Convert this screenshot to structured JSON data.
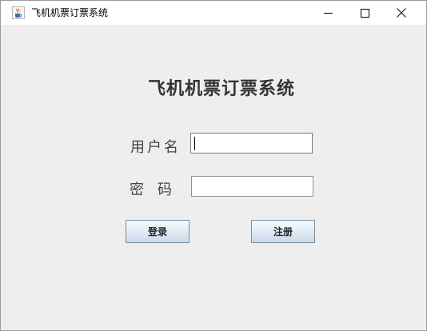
{
  "window": {
    "title": "飞机机票订票系统",
    "icons": {
      "app": "java-cup-icon",
      "minimize": "minimize-icon",
      "maximize": "maximize-icon",
      "close": "close-icon"
    }
  },
  "form": {
    "heading": "飞机机票订票系统",
    "username_label": "用户名",
    "username_value": "",
    "password_label": "密码",
    "password_value": "",
    "login_button": "登录",
    "register_button": "注册"
  },
  "colors": {
    "window_bg": "#eeeeee",
    "titlebar_bg": "#ffffff",
    "button_gradient_end": "#c9d9e8"
  }
}
